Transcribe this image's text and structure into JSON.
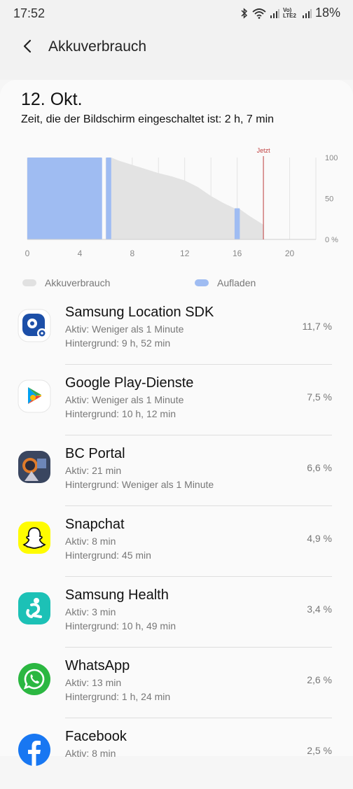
{
  "status_bar": {
    "time": "17:52",
    "network": "Vo) LTE2",
    "battery": "18%"
  },
  "header": {
    "title": "Akkuverbrauch"
  },
  "date": "12. Okt.",
  "screen_time": "Zeit, die der Bildschirm eingeschaltet ist: 2 h, 7 min",
  "chart_data": {
    "type": "area",
    "x_ticks": [
      "0",
      "4",
      "8",
      "12",
      "16",
      "20"
    ],
    "y_ticks": [
      "100",
      "50",
      "0 %"
    ],
    "now_label": "Jetzt",
    "now_hour": 18,
    "xlim": [
      0,
      22
    ],
    "ylim": [
      0,
      100
    ],
    "charging_intervals": [
      [
        0,
        5.7
      ],
      [
        6.0,
        6.4
      ],
      [
        15.8,
        16.2
      ]
    ],
    "usage": [
      {
        "x": 6.4,
        "y": 100
      },
      {
        "x": 7,
        "y": 96
      },
      {
        "x": 8,
        "y": 91
      },
      {
        "x": 9,
        "y": 86
      },
      {
        "x": 10,
        "y": 81
      },
      {
        "x": 11,
        "y": 77
      },
      {
        "x": 12,
        "y": 72
      },
      {
        "x": 13,
        "y": 64
      },
      {
        "x": 14,
        "y": 53
      },
      {
        "x": 15,
        "y": 44
      },
      {
        "x": 15.8,
        "y": 38
      },
      {
        "x": 16.2,
        "y": 37
      },
      {
        "x": 17,
        "y": 28
      },
      {
        "x": 18,
        "y": 18
      }
    ],
    "legend": [
      {
        "label": "Akkuverbrauch",
        "color": "#e1e1e1"
      },
      {
        "label": "Aufladen",
        "color": "#9fbcf2"
      }
    ],
    "colors": {
      "usage": "#e3e3e3",
      "charging": "#9fbcf2",
      "now": "#c04040"
    }
  },
  "apps": [
    {
      "name": "Samsung Location SDK",
      "active": "Aktiv: Weniger als 1 Minute",
      "background": "Hintergrund: 9 h, 52 min",
      "percent": "11,7 %",
      "icon": "samsung-location-icon"
    },
    {
      "name": "Google Play-Dienste",
      "active": "Aktiv: Weniger als 1 Minute",
      "background": "Hintergrund: 10 h, 12 min",
      "percent": "7,5 %",
      "icon": "google-play-services-icon"
    },
    {
      "name": "BC Portal",
      "active": "Aktiv: 21 min",
      "background": "Hintergrund: Weniger als 1 Minute",
      "percent": "6,6 %",
      "icon": "bc-portal-icon"
    },
    {
      "name": "Snapchat",
      "active": "Aktiv: 8 min",
      "background": "Hintergrund: 45 min",
      "percent": "4,9 %",
      "icon": "snapchat-icon"
    },
    {
      "name": "Samsung Health",
      "active": "Aktiv: 3 min",
      "background": "Hintergrund: 10 h, 49 min",
      "percent": "3,4 %",
      "icon": "samsung-health-icon"
    },
    {
      "name": "WhatsApp",
      "active": "Aktiv: 13 min",
      "background": "Hintergrund: 1 h, 24 min",
      "percent": "2,6 %",
      "icon": "whatsapp-icon"
    },
    {
      "name": "Facebook",
      "active": "Aktiv: 8 min",
      "background": "",
      "percent": "2,5 %",
      "icon": "facebook-icon"
    }
  ]
}
